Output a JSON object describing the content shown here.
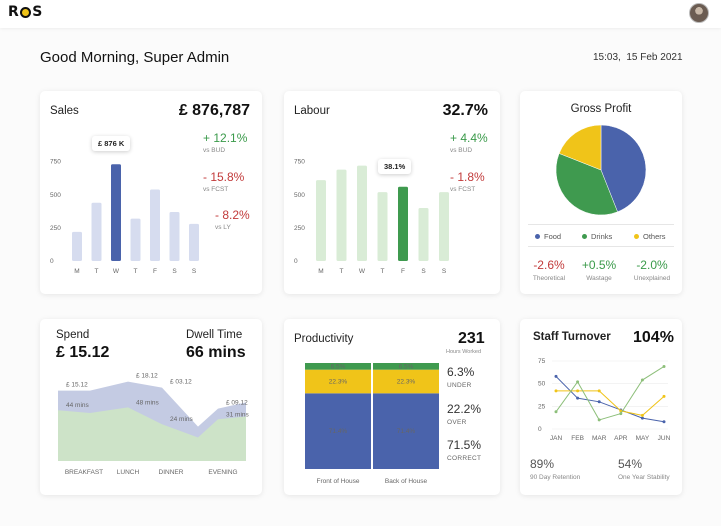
{
  "header": {
    "logo": "ROS"
  },
  "greeting": "Good Morning, Super Admin",
  "datetime": "15:03,  15 Feb 2021",
  "sales": {
    "title": "Sales",
    "total": "£ 876,787",
    "tooltip": "£ 876 K",
    "stats": [
      {
        "value": "+ 12.1%",
        "sub": "vs BUD",
        "color": "green"
      },
      {
        "value": "- 15.8%",
        "sub": "vs FCST",
        "color": "red"
      },
      {
        "value": "- 8.2%",
        "sub": "vs LY",
        "color": "red"
      }
    ]
  },
  "labour": {
    "title": "Labour",
    "total": "32.7%",
    "tooltip": "38.1%",
    "stats": [
      {
        "value": "+ 4.4%",
        "sub": "vs BUD",
        "color": "green"
      },
      {
        "value": "- 1.8%",
        "sub": "vs FCST",
        "color": "red"
      }
    ]
  },
  "gross_profit": {
    "title": "Gross Profit",
    "legend": [
      "Food",
      "Drinks",
      "Others"
    ],
    "stats": [
      {
        "value": "-2.6%",
        "sub": "Theoretical",
        "color": "red"
      },
      {
        "value": "+0.5%",
        "sub": "Wastage",
        "color": "green"
      },
      {
        "value": "-2.0%",
        "sub": "Unexplained",
        "color": "green"
      }
    ]
  },
  "spend": {
    "title": "Spend",
    "value": "£ 15.12"
  },
  "dwell": {
    "title": "Dwell Time",
    "value": "66 mins"
  },
  "productivity": {
    "title": "Productivity",
    "hours": "231",
    "hours_label": "Hours Worked",
    "stats": [
      {
        "value": "6.3%",
        "label": "UNDER"
      },
      {
        "value": "22.2%",
        "label": "OVER"
      },
      {
        "value": "71.5%",
        "label": "CORRECT"
      }
    ]
  },
  "staff_turnover": {
    "title": "Staff Turnover",
    "total": "104%",
    "stats": [
      {
        "value": "89%",
        "sub": "90 Day Retention"
      },
      {
        "value": "54%",
        "sub": "One Year Stability"
      }
    ]
  },
  "colors": {
    "blue": "#4a63ab",
    "green": "#3f9a4f",
    "yellow": "#f0c419",
    "light_blue": "#d6dcef",
    "light_green": "#d9ecd6"
  },
  "chart_data": [
    {
      "id": "sales",
      "type": "bar",
      "categories": [
        "M",
        "T",
        "W",
        "T",
        "F",
        "S",
        "S"
      ],
      "values": [
        220,
        440,
        730,
        320,
        540,
        370,
        280
      ],
      "yticks": [
        0,
        250,
        500,
        750
      ],
      "ylim": [
        0,
        800
      ],
      "highlight_index": 2
    },
    {
      "id": "labour",
      "type": "bar",
      "categories": [
        "M",
        "T",
        "W",
        "T",
        "F",
        "S",
        "S"
      ],
      "values": [
        610,
        690,
        720,
        520,
        560,
        400,
        520
      ],
      "yticks": [
        0,
        250,
        500,
        750
      ],
      "ylim": [
        0,
        800
      ],
      "highlight_index": 4
    },
    {
      "id": "gross_profit",
      "type": "pie",
      "labels": [
        "Food",
        "Drinks",
        "Others"
      ],
      "values": [
        44,
        37,
        19
      ]
    },
    {
      "id": "spend",
      "type": "area",
      "categories": [
        "BREAKFAST",
        "LUNCH",
        "DINNER",
        "EVENING"
      ],
      "series": [
        {
          "values": [
            15.12,
            15.12,
            18.12,
            16.12,
            3.12,
            9.12,
            11.2
          ],
          "labels": [
            "£ 15.12",
            "",
            "£ 18.12",
            "£ 03.12",
            "",
            "£ 09.12",
            ""
          ]
        },
        {
          "values": [
            44,
            40,
            48,
            24,
            5,
            31,
            35
          ],
          "labels": [
            "44 mins",
            "",
            "48 mins",
            "24 mins",
            "",
            "31 mins",
            ""
          ]
        }
      ]
    },
    {
      "id": "productivity",
      "type": "bar",
      "categories": [
        "Front of House",
        "Back of House"
      ],
      "series": [
        {
          "name": "CORRECT",
          "values": [
            71.4,
            71.4
          ]
        },
        {
          "name": "OVER",
          "values": [
            22.3,
            22.3
          ]
        },
        {
          "name": "UNDER",
          "values": [
            6.3,
            6.3
          ]
        }
      ],
      "labels": [
        "71.4%",
        "22.3%",
        "6.5%"
      ]
    },
    {
      "id": "staff_turnover",
      "type": "line",
      "categories": [
        "JAN",
        "FEB",
        "MAR",
        "APR",
        "MAY",
        "JUN"
      ],
      "yticks": [
        0,
        25,
        50,
        75
      ],
      "ylim": [
        0,
        75
      ],
      "series": [
        {
          "color": "#4a63ab",
          "values": [
            58,
            34,
            30,
            21,
            12,
            8
          ]
        },
        {
          "color": "#f0c419",
          "values": [
            42,
            42,
            42,
            20,
            15,
            36
          ]
        },
        {
          "color": "#8dbf7a",
          "values": [
            19,
            52,
            10,
            17,
            54,
            69
          ]
        }
      ]
    }
  ]
}
